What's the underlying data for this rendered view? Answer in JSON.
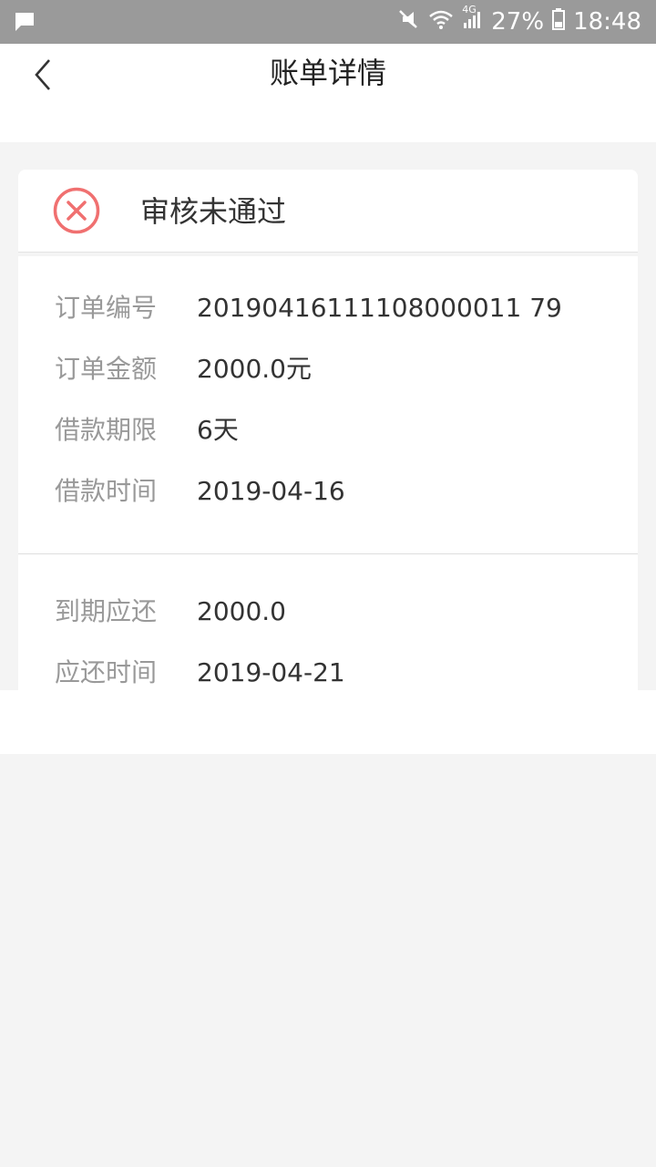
{
  "status_bar": {
    "battery_percent": "27%",
    "time": "18:48",
    "network": "4G",
    "icons": [
      "chat-bubble-icon",
      "mute-icon",
      "wifi-icon",
      "signal-icon",
      "battery-icon"
    ]
  },
  "header": {
    "title": "账单详情",
    "back_icon": "chevron-left-icon"
  },
  "status": {
    "text": "审核未通过",
    "icon": "close-circle-icon",
    "color": "#f07070"
  },
  "details": {
    "order_no": {
      "label": "订单编号",
      "value": "20190416111108000011 79"
    },
    "amount": {
      "label": "订单金额",
      "value": "2000.0元"
    },
    "term": {
      "label": "借款期限",
      "value": "6天"
    },
    "loan_time": {
      "label": "借款时间",
      "value": "2019-04-16"
    },
    "due_amount": {
      "label": "到期应还",
      "value": "2000.0"
    },
    "due_time": {
      "label": "应还时间",
      "value": "2019-04-21"
    }
  }
}
